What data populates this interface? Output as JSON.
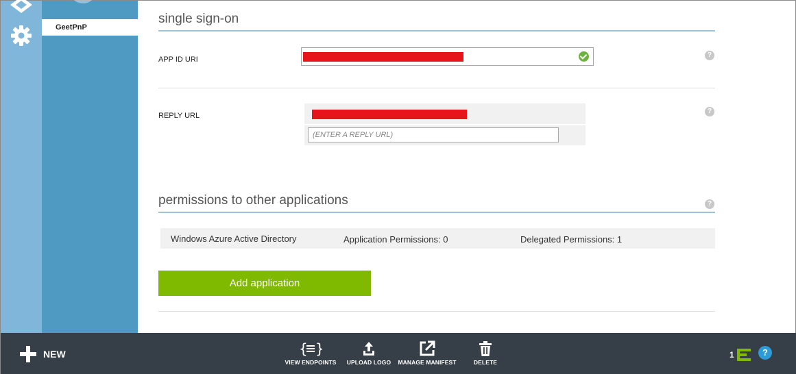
{
  "sidebar": {
    "active_item": "GeetPnP"
  },
  "single_sign_on": {
    "title": "single sign-on",
    "app_id_label": "APP ID URI",
    "reply_url_label": "REPLY URL",
    "reply_url_placeholder": "(ENTER A REPLY URL)",
    "help": "?"
  },
  "permissions": {
    "title": "permissions to other applications",
    "rows": [
      {
        "application": "Windows Azure Active Directory",
        "app_permissions": "Application Permissions: 0",
        "delegated_permissions": "Delegated Permissions: 1"
      }
    ],
    "add_button": "Add application"
  },
  "command_bar": {
    "new_label": "NEW",
    "view_endpoints": "VIEW ENDPOINTS",
    "upload_logo": "UPLOAD LOGO",
    "manage_manifest": "MANAGE MANIFEST",
    "delete": "DELETE",
    "notification_count": "1",
    "help": "?"
  },
  "colors": {
    "accent_green": "#7fba00",
    "rail_blue": "#7fb6d9",
    "subnav_blue": "#4e9ac3",
    "command_bar": "#363e47",
    "redaction": "#e8141c",
    "check_green": "#6cb33e"
  },
  "icons": [
    "portal-logo-icon",
    "gear-icon",
    "check-icon",
    "help-icon",
    "plus-icon",
    "endpoints-icon",
    "upload-icon",
    "external-link-icon",
    "trash-icon",
    "notifications-icon"
  ]
}
